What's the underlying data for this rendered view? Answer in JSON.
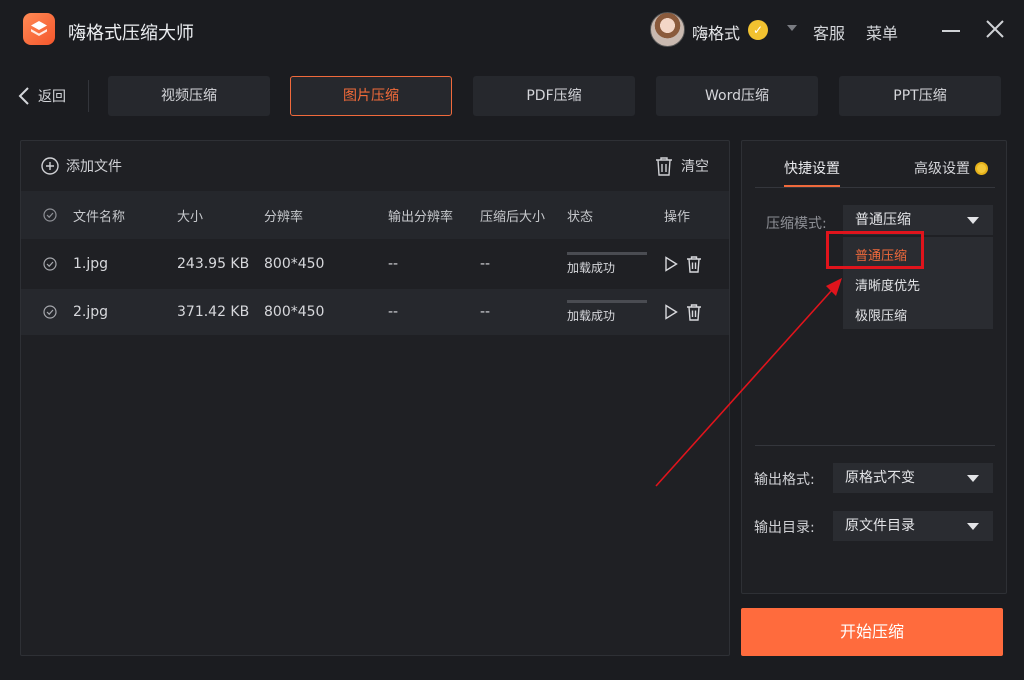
{
  "app": {
    "title": "嗨格式压缩大师"
  },
  "user": {
    "name": "嗨格式",
    "badge": "✓"
  },
  "header": {
    "service": "客服",
    "menu": "菜单"
  },
  "nav": {
    "back": "返回",
    "tabs": [
      "视频压缩",
      "图片压缩",
      "PDF压缩",
      "Word压缩",
      "PPT压缩"
    ],
    "active_index": 1
  },
  "toolbar": {
    "add_file": "添加文件",
    "clear": "清空"
  },
  "table": {
    "columns": [
      "文件名称",
      "大小",
      "分辨率",
      "输出分辨率",
      "压缩后大小",
      "状态",
      "操作"
    ],
    "rows": [
      {
        "name": "1.jpg",
        "size": "243.95 KB",
        "resolution": "800*450",
        "output_resolution": "--",
        "compressed_size": "--",
        "status": "加载成功",
        "progress": 1.0
      },
      {
        "name": "2.jpg",
        "size": "371.42 KB",
        "resolution": "800*450",
        "output_resolution": "--",
        "compressed_size": "--",
        "status": "加载成功",
        "progress": 1.0
      }
    ]
  },
  "settings": {
    "tabs": {
      "quick": "快捷设置",
      "advanced": "高级设置"
    },
    "mode_label": "压缩模式:",
    "mode_value": "普通压缩",
    "mode_options": [
      "普通压缩",
      "清晰度优先",
      "极限压缩"
    ],
    "output_format_label": "输出格式:",
    "output_format_value": "原格式不变",
    "output_dir_label": "输出目录:",
    "output_dir_value": "原文件目录"
  },
  "start_button": "开始压缩",
  "colors": {
    "accent": "#f06a3c",
    "highlight": "#e0141c",
    "background": "#1b1c20"
  }
}
